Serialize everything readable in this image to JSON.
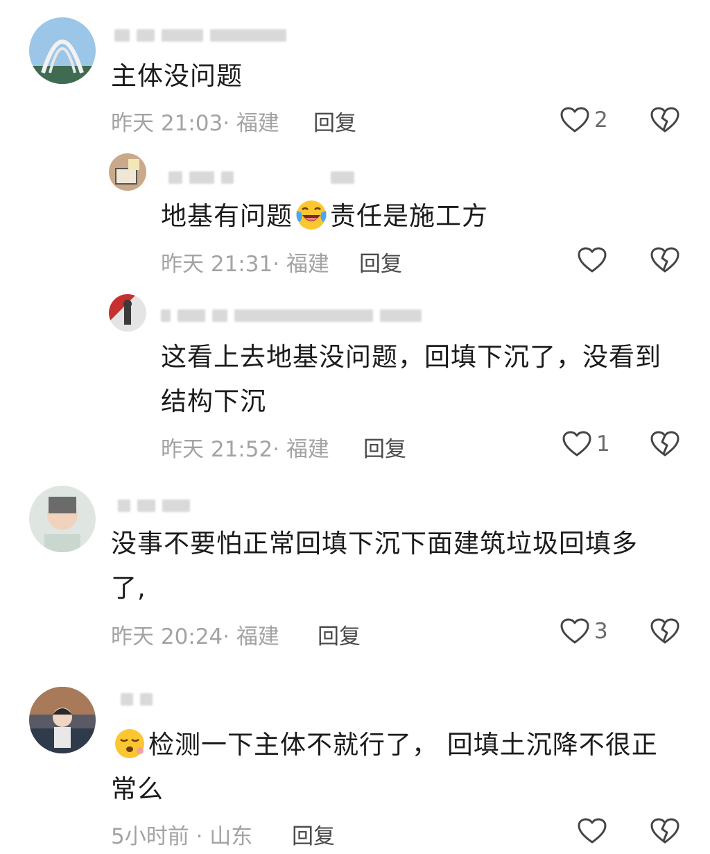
{
  "comments": [
    {
      "text": "主体没问题",
      "time_location": "昨天 21:03· 福建",
      "reply_label": "回复",
      "likes": "2"
    },
    {
      "text_before_emoji": "地基有问题",
      "emoji": "laughing-crying-emoji",
      "text_after_emoji": "责任是施工方",
      "time_location": "昨天 21:31· 福建",
      "reply_label": "回复",
      "likes": ""
    },
    {
      "text_line1": "这看上去地基没问题，回填下沉了，没看到",
      "text_line2": "结构下沉",
      "time_location": "昨天 21:52· 福建",
      "reply_label": "回复",
      "likes": "1"
    },
    {
      "text_line1": "没事不要怕正常回填下沉下面建筑垃圾回填多",
      "text_line2": "了,",
      "time_location": "昨天 20:24· 福建",
      "reply_label": "回复",
      "likes": "3"
    },
    {
      "emoji": "sleepy-face-emoji",
      "text_line1": "检测一下主体不就行了， 回填土沉降不很正",
      "text_line2": "常么",
      "time_location": "5小时前 · 山东",
      "reply_label": "回复",
      "likes": ""
    }
  ],
  "icons": {
    "like": "heart-outline-icon",
    "dislike": "broken-heart-icon"
  },
  "colors": {
    "meta_text": "#a3a3a3",
    "body_text": "#1b1b1b",
    "icon_stroke": "#444444"
  }
}
